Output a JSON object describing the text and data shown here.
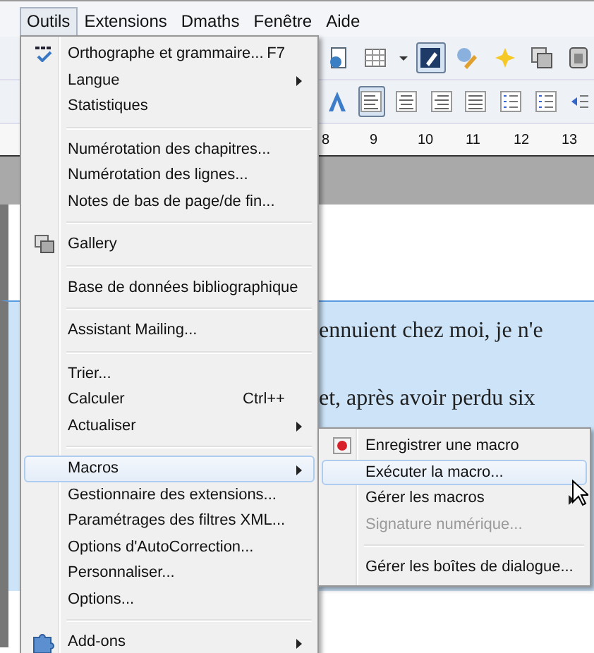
{
  "menubar": [
    {
      "label": "Outils",
      "selected": true
    },
    {
      "label": "Extensions",
      "selected": false
    },
    {
      "label": "Dmaths",
      "selected": false
    },
    {
      "label": "Fenêtre",
      "selected": false
    },
    {
      "label": "Aide",
      "selected": false
    }
  ],
  "toolbar_1": [
    {
      "kind": "document",
      "pressed": false
    },
    {
      "kind": "table",
      "pressed": false
    },
    {
      "kind": "caret",
      "pressed": false
    },
    {
      "kind": "draw",
      "pressed": true
    },
    {
      "kind": "pencil",
      "pressed": false
    },
    {
      "kind": "star",
      "pressed": false
    },
    {
      "kind": "copy",
      "pressed": false
    },
    {
      "kind": "box",
      "pressed": false
    }
  ],
  "toolbar_2": [
    {
      "kind": "fontwork",
      "pressed": false
    },
    {
      "kind": "align-left",
      "pressed": true
    },
    {
      "kind": "align-center",
      "pressed": false
    },
    {
      "kind": "align-right",
      "pressed": false
    },
    {
      "kind": "justify",
      "pressed": false
    },
    {
      "kind": "numbering",
      "pressed": false
    },
    {
      "kind": "bullets",
      "pressed": false
    },
    {
      "kind": "indent",
      "pressed": false
    }
  ],
  "ruler": {
    "marks": [
      "8",
      "9",
      "10",
      "11",
      "12",
      "13"
    ]
  },
  "document": {
    "lines": [
      "ennuient chez moi, je n'e",
      "et, après avoir perdu six"
    ]
  },
  "menu": {
    "groups": [
      [
        {
          "label": "Orthographe et grammaire...",
          "shortcut": "F7",
          "kind": "spellcheck",
          "submenu": false,
          "selected": false,
          "disabled": false
        },
        {
          "label": "Langue",
          "submenu": true,
          "selected": false,
          "disabled": false
        },
        {
          "label": "Statistiques",
          "submenu": false,
          "selected": false,
          "disabled": false
        }
      ],
      [
        {
          "label": "Numérotation des chapitres...",
          "submenu": false,
          "selected": false,
          "disabled": false
        },
        {
          "label": "Numérotation des lignes...",
          "submenu": false,
          "selected": false,
          "disabled": false
        },
        {
          "label": "Notes de bas de page/de fin...",
          "submenu": false,
          "selected": false,
          "disabled": false
        }
      ],
      [
        {
          "label": "Gallery",
          "kind": "gallery",
          "submenu": false,
          "selected": false,
          "disabled": false
        }
      ],
      [
        {
          "label": "Base de données bibliographique",
          "submenu": false,
          "selected": false,
          "disabled": false
        }
      ],
      [
        {
          "label": "Assistant Mailing...",
          "submenu": false,
          "selected": false,
          "disabled": false
        }
      ],
      [
        {
          "label": "Trier...",
          "submenu": false,
          "selected": false,
          "disabled": false
        },
        {
          "label": "Calculer",
          "shortcut": "Ctrl++",
          "submenu": false,
          "selected": false,
          "disabled": false
        },
        {
          "label": "Actualiser",
          "submenu": true,
          "selected": false,
          "disabled": false
        }
      ],
      [
        {
          "label": "Macros",
          "submenu": true,
          "selected": true,
          "disabled": false
        },
        {
          "label": "Gestionnaire des extensions...",
          "submenu": false,
          "selected": false,
          "disabled": false
        },
        {
          "label": "Paramétrages des filtres XML...",
          "submenu": false,
          "selected": false,
          "disabled": false
        },
        {
          "label": "Options d'AutoCorrection...",
          "submenu": false,
          "selected": false,
          "disabled": false
        },
        {
          "label": "Personnaliser...",
          "submenu": false,
          "selected": false,
          "disabled": false
        },
        {
          "label": "Options...",
          "submenu": false,
          "selected": false,
          "disabled": false
        }
      ],
      [
        {
          "label": "Add-ons",
          "kind": "addons",
          "submenu": true,
          "selected": false,
          "disabled": false
        }
      ]
    ]
  },
  "submenu": {
    "groups": [
      [
        {
          "label": "Enregistrer une macro",
          "kind": "record",
          "submenu": false,
          "selected": false,
          "disabled": false
        },
        {
          "label": "Exécuter la macro...",
          "submenu": false,
          "selected": true,
          "disabled": false
        },
        {
          "label": "Gérer les macros",
          "submenu": true,
          "selected": false,
          "disabled": false
        },
        {
          "label": "Signature numérique...",
          "submenu": false,
          "selected": false,
          "disabled": true
        }
      ],
      [
        {
          "label": "Gérer les boîtes de dialogue...",
          "submenu": false,
          "selected": false,
          "disabled": false
        }
      ]
    ]
  }
}
